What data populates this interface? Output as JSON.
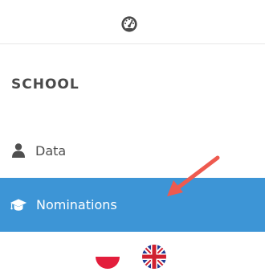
{
  "header": {
    "icon": "dashboard-gauge-icon"
  },
  "sidebar": {
    "section_title": "SCHOOL",
    "items": [
      {
        "label": "Data",
        "icon": "user-icon",
        "active": false
      },
      {
        "label": "Nominations",
        "icon": "graduation-cap-icon",
        "active": true
      }
    ]
  },
  "languages": [
    {
      "code": "pl",
      "icon": "poland-flag-icon"
    },
    {
      "code": "en-GB",
      "icon": "uk-flag-icon"
    }
  ],
  "colors": {
    "active_background": "#3d95d6",
    "annotation_arrow": "#ee5a4f",
    "section_title": "#4a4a4a",
    "nav_text": "#4f4f4f"
  }
}
